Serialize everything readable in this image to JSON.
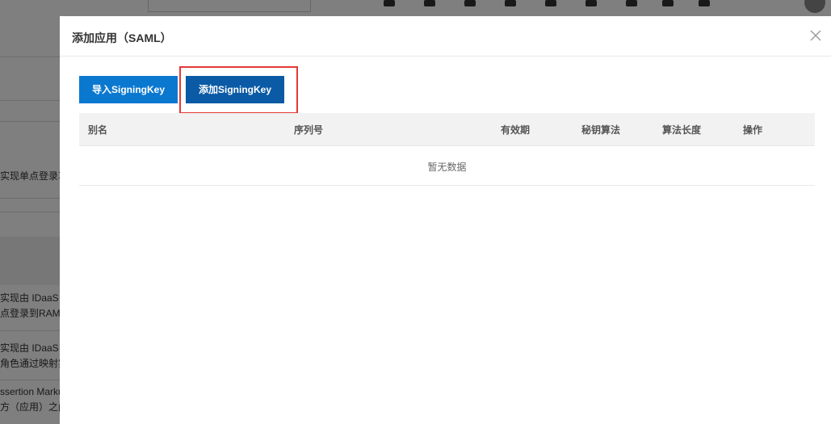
{
  "background": {
    "snippets": [
      "实现单点登录功",
      "实现由 IDaaS",
      "点登录到RAM",
      "实现由 IDaaS",
      "角色通过映射实",
      "ssertion Marku",
      "方（应用）之间"
    ]
  },
  "drawer": {
    "title": "添加应用（SAML）",
    "buttons": {
      "import_label": "导入SigningKey",
      "add_label": "添加SigningKey"
    },
    "table": {
      "columns": [
        "别名",
        "序列号",
        "有效期",
        "秘钥算法",
        "算法长度",
        "操作"
      ],
      "empty_text": "暂无数据"
    }
  },
  "colors": {
    "primary": "#0b78d0",
    "primary_dark": "#0a5aa5",
    "highlight": "#e53935"
  }
}
